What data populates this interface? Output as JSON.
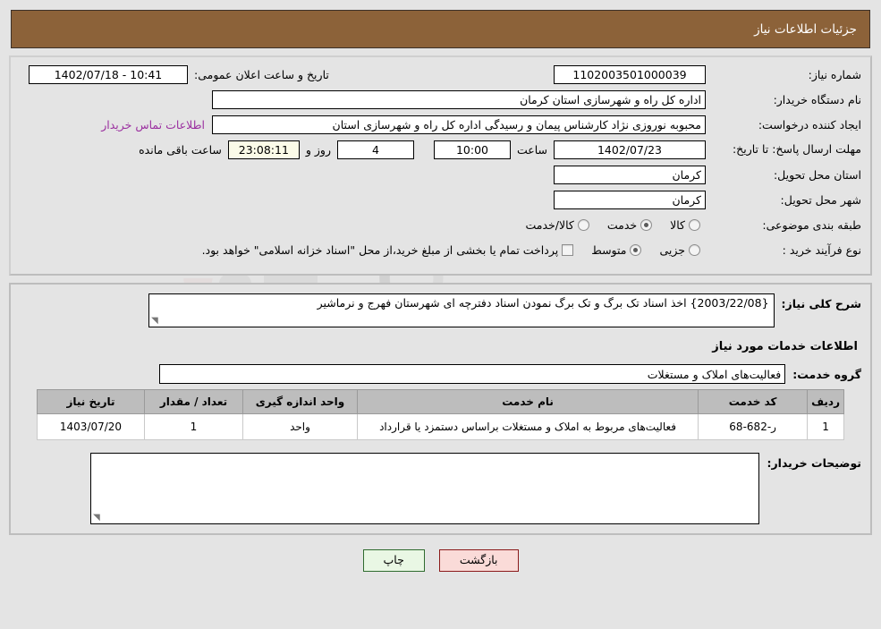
{
  "header": {
    "title": "جزئیات اطلاعات نیاز",
    "bg_color": "#8c6239"
  },
  "form": {
    "need_number": {
      "label": "شماره نیاز:",
      "value": "1102003501000039"
    },
    "public_announce": {
      "label": "تاریخ و ساعت اعلان عمومی:",
      "value": "1402/07/18 - 10:41"
    },
    "buyer_org": {
      "label": "نام دستگاه خریدار:",
      "value": "اداره کل راه و شهرسازی استان کرمان"
    },
    "request_creator": {
      "label": "ایجاد کننده درخواست:",
      "value": "محبوبه نوروزی نژاد کارشناس پیمان و رسیدگی اداره کل راه و شهرسازی استان"
    },
    "contact_link": {
      "label": "اطلاعات تماس خریدار",
      "color": "#9b30a0"
    },
    "deadline": {
      "label": "مهلت ارسال پاسخ: تا تاریخ:",
      "date": "1402/07/23",
      "time_label": "ساعت",
      "time": "10:00",
      "days": "4",
      "days_label": "روز و",
      "remaining": "23:08:11",
      "remaining_label": "ساعت باقی مانده"
    },
    "delivery_province": {
      "label": "استان محل تحویل:",
      "value": "کرمان"
    },
    "delivery_city": {
      "label": "شهر محل تحویل:",
      "value": "کرمان"
    },
    "category": {
      "label": "طبقه بندی موضوعی:",
      "options": [
        {
          "label": "کالا",
          "selected": false
        },
        {
          "label": "خدمت",
          "selected": true
        },
        {
          "label": "کالا/خدمت",
          "selected": false
        }
      ]
    },
    "purchase_type": {
      "label": "نوع فرآیند خرید :",
      "options": [
        {
          "label": "جزیی",
          "selected": false
        },
        {
          "label": "متوسط",
          "selected": true
        }
      ],
      "checkbox": {
        "label": "پرداخت تمام یا بخشی از مبلغ خرید،از محل \"اسناد خزانه اسلامی\" خواهد بود.",
        "checked": false
      }
    }
  },
  "description": {
    "label": "شرح کلی نیاز:",
    "value": "{2003/22/08} اخذ اسناد تک برگ و تک برگ نمودن اسناد دفترچه ای شهرستان فهرج و نرماشیر"
  },
  "services": {
    "section_title": "اطلاعات خدمات مورد نیاز",
    "group": {
      "label": "گروه خدمت:",
      "value": "فعالیت‌های  املاک و مستغلات"
    },
    "table": {
      "columns": [
        "ردیف",
        "کد خدمت",
        "نام خدمت",
        "واحد اندازه گیری",
        "تعداد / مقدار",
        "تاریخ نیاز"
      ],
      "rows": [
        {
          "index": "1",
          "service_code": "ر-682-68",
          "service_name": "فعالیت‌های مربوط به املاک و مستغلات براساس دستمزد یا قرارداد",
          "unit": "واحد",
          "quantity": "1",
          "need_date": "1403/07/20"
        }
      ]
    }
  },
  "buyer_notes": {
    "label": "توضیحات خریدار:",
    "value": ""
  },
  "buttons": {
    "back": {
      "label": "بازگشت",
      "bg": "#fadbd8"
    },
    "print": {
      "label": "چاپ",
      "bg": "#e9f7e4"
    }
  }
}
